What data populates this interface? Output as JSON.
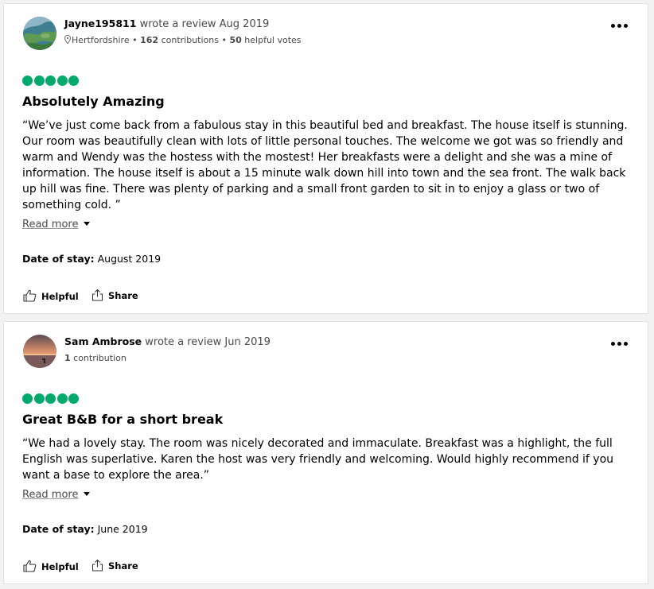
{
  "accent_color": "#00aa6c",
  "reviews": [
    {
      "username": "Jayne195811",
      "wrote_text": "wrote a review Aug 2019",
      "location": "Hertfordshire",
      "contributions": "162",
      "contributions_label": "contributions",
      "helpful_votes": "50",
      "helpful_votes_label": "helpful votes",
      "rating": 5,
      "title": "Absolutely Amazing",
      "body": "“We’ve just come back from a fabulous stay in this beautiful bed and breakfast. The house itself is stunning. Our room was beautifully clean with lots of little personal touches. The welcome we got was so friendly and warm and Wendy was the hostess with the mostest! Her breakfasts were a delight and she was a mine of information. The house itself is about a 15 minute walk down hill into town and the sea front. The walk back up hill was fine. There was plenty of parking and a small front garden to sit in to enjoy a glass or two of something cold. ”",
      "read_more": "Read more",
      "date_of_stay_label": "Date of stay",
      "date_of_stay": "August 2019",
      "helpful_label": "Helpful",
      "share_label": "Share"
    },
    {
      "username": "Sam Ambrose",
      "wrote_text": "wrote a review Jun 2019",
      "contributions": "1",
      "contributions_label": "contribution",
      "rating": 5,
      "title": "Great B&B for a short break",
      "body": "“We had a lovely stay. The room was nicely decorated and immaculate. Breakfast was a highlight, the full English was superlative. Karen the host was very friendly and welcoming. Would highly recommend if you want a base to explore the area.”",
      "read_more": "Read more",
      "date_of_stay_label": "Date of stay",
      "date_of_stay": "June 2019",
      "helpful_label": "Helpful",
      "share_label": "Share"
    }
  ]
}
